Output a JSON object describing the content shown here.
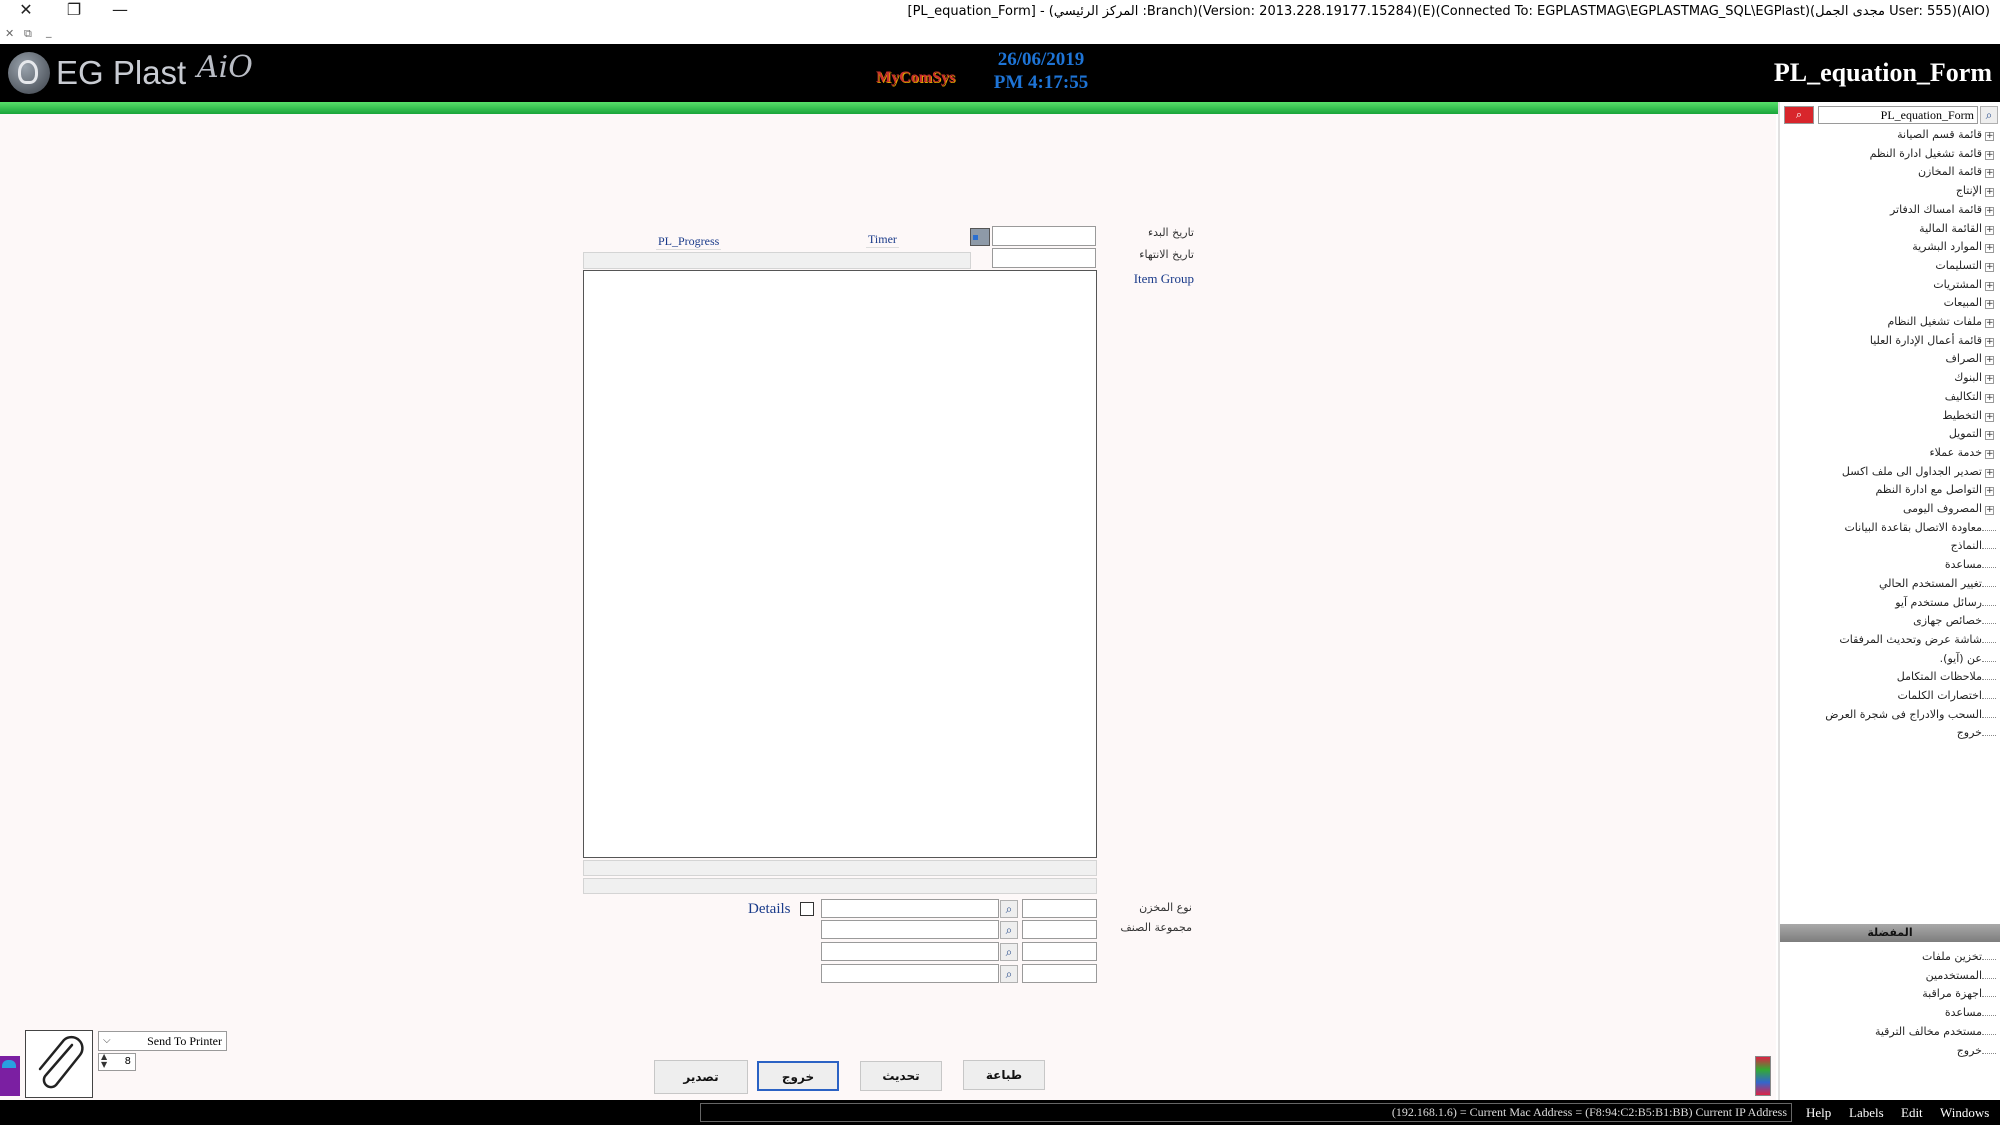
{
  "window": {
    "title": "[PL_equation_Form] - (المركز الرئيسي :Branch)(Version: 2013.228.19177.15284)(E)(Connected To: EGPLASTMAG\\EGPLASTMAG_SQL\\EGPlast)(مجدى الجمل User: 555)(AIO)",
    "close_glyph": "✕",
    "restore_glyph": "❐",
    "minimize_glyph": "—",
    "mdi_close": "✕",
    "mdi_restore": "⧉",
    "mdi_minimize": "_"
  },
  "header": {
    "logo_text": "EG Plast",
    "logo_suffix": "AiO",
    "brand": "MyComSys",
    "date": "26/06/2019",
    "time": "PM 4:17:55",
    "form_title": "PL_equation_Form",
    "colors": {
      "background": "#000000",
      "accent_green": "#2ecc40",
      "date_blue": "#1e74d6"
    }
  },
  "form": {
    "start_date_label": "تاريخ البدء",
    "end_date_label": "تاريخ الانتهاء",
    "start_date_value": "",
    "end_date_value": "",
    "calendar_icon": "calendar-icon",
    "progress_label": "PL_Progress",
    "timer_label": "Timer",
    "item_group_label": "Item Group",
    "store_type_label": "نوع المخزن",
    "item_group_ar_label": "مجموعة الصنف",
    "details_label": "Details",
    "details_checked": false
  },
  "print": {
    "send_option": "Send To Printer",
    "copies": "8"
  },
  "buttons": {
    "export": "تصدير",
    "exit": "خروج",
    "refresh": "تحديث",
    "print": "طباعة"
  },
  "sidebar": {
    "search_value": "PL_equation_Form",
    "tree": [
      {
        "label": "قائمة قسم الصيانة",
        "expandable": true
      },
      {
        "label": "قائمة تشغيل ادارة النظم",
        "expandable": true
      },
      {
        "label": "قائمة المخازن",
        "expandable": true
      },
      {
        "label": "الإنتاج",
        "expandable": true
      },
      {
        "label": "قائمة امساك الدفاتر",
        "expandable": true
      },
      {
        "label": "القائمة المالية",
        "expandable": true
      },
      {
        "label": "الموارد البشرية",
        "expandable": true
      },
      {
        "label": "التسليمات",
        "expandable": true
      },
      {
        "label": "المشتريات",
        "expandable": true
      },
      {
        "label": "المبيعات",
        "expandable": true
      },
      {
        "label": "ملفات تشغيل النظام",
        "expandable": true
      },
      {
        "label": "قائمة أعمال الإدارة العليا",
        "expandable": true
      },
      {
        "label": "الصراف",
        "expandable": true
      },
      {
        "label": "البنوك",
        "expandable": true
      },
      {
        "label": "التكاليف",
        "expandable": true
      },
      {
        "label": "التخطيط",
        "expandable": true
      },
      {
        "label": "التمويل",
        "expandable": true
      },
      {
        "label": "خدمة عملاء",
        "expandable": true
      },
      {
        "label": "تصدير الجداول الى ملف اكسل",
        "expandable": true
      },
      {
        "label": "التواصل مع ادارة النظم",
        "expandable": true
      },
      {
        "label": "المصروف اليومى",
        "expandable": true
      },
      {
        "label": "معاودة الاتصال بقاعدة البيانات",
        "expandable": false
      },
      {
        "label": "النماذج",
        "expandable": false
      },
      {
        "label": "مساعدة",
        "expandable": false
      },
      {
        "label": "تغيير المستخدم الحالي",
        "expandable": false
      },
      {
        "label": "رسائل مستخدم آيو",
        "expandable": false
      },
      {
        "label": "خصائص جهازى",
        "expandable": false
      },
      {
        "label": "شاشة عرض وتحديث المرفقات",
        "expandable": false
      },
      {
        "label": "عن (آيو).",
        "expandable": false
      },
      {
        "label": "ملاحظات المتكامل",
        "expandable": false
      },
      {
        "label": "اختصارات الكلمات",
        "expandable": false
      },
      {
        "label": "السحب والادراج فى شجرة العرض",
        "expandable": false
      },
      {
        "label": "خروج",
        "expandable": false
      }
    ],
    "shortcuts_header": "المفضلة",
    "shortcuts": [
      "تخزين ملفات",
      "المستخدمين",
      "اجهزة مراقبة",
      "مساعدة",
      "مستخدم مخالف الترقية",
      "خروج"
    ]
  },
  "statusbar": {
    "network_info": "(192.168.1.6) = Current Mac Address = (F8:94:C2:B5:B1:BB) Current IP Address",
    "menus": [
      "Help",
      "Labels",
      "Edit",
      "Windows"
    ]
  }
}
